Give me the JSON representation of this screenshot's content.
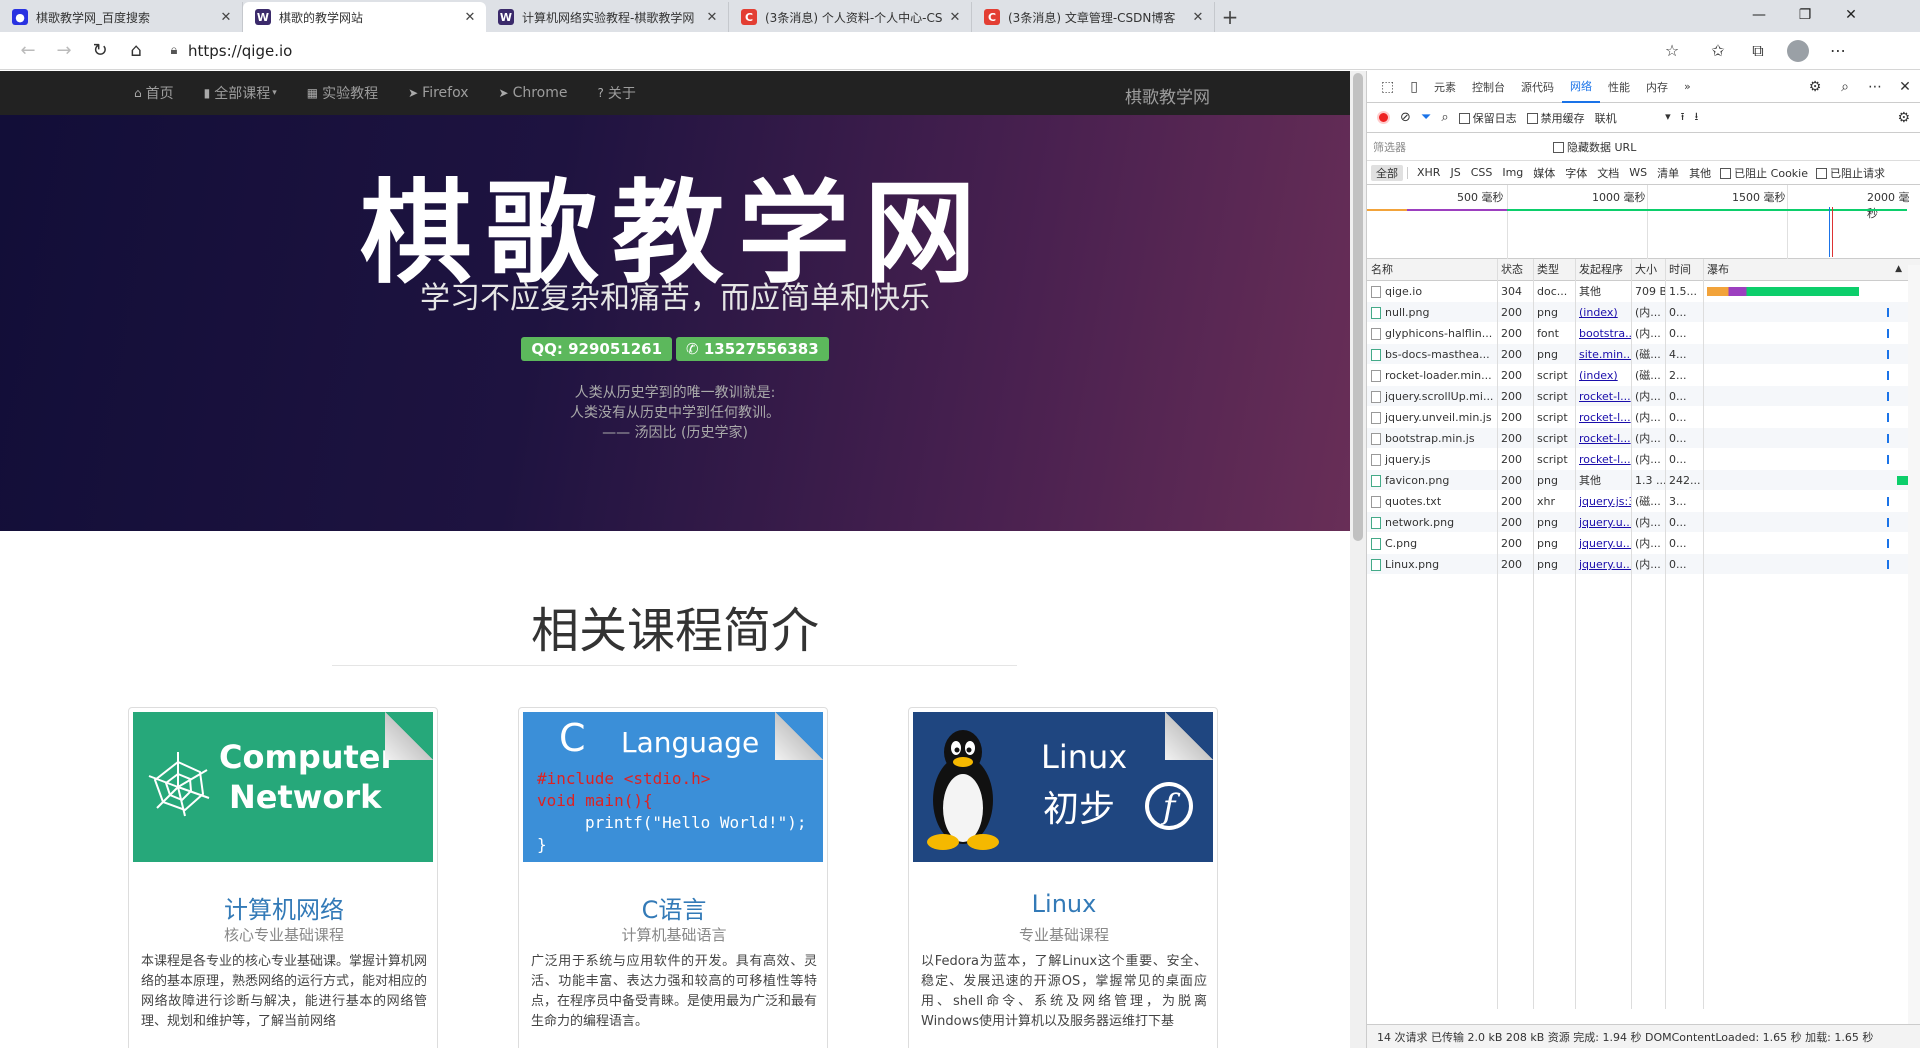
{
  "browser": {
    "tabs": [
      {
        "title": "棋歌教学网_百度搜索",
        "favicon": "paw",
        "color": "#2932e1"
      },
      {
        "title": "棋歌的教学网站",
        "favicon": "W",
        "color": "#3b2a6b",
        "active": true
      },
      {
        "title": "计算机网络实验教程-棋歌教学网",
        "favicon": "W",
        "color": "#3b2a6b"
      },
      {
        "title": "(3条消息) 个人资料-个人中心-CS",
        "favicon": "C",
        "color": "#e33e33"
      },
      {
        "title": "(3条消息) 文章管理-CSDN博客",
        "favicon": "C",
        "color": "#e33e33"
      }
    ],
    "address": "https://qige.io"
  },
  "site": {
    "nav": {
      "home": "首页",
      "courses": "全部课程",
      "labs": "实验教程",
      "firefox": "Firefox",
      "chrome": "Chrome",
      "about": "关于"
    },
    "brand": "棋歌教学网",
    "hero": {
      "title": "棋歌教学网",
      "subtitle": "学习不应复杂和痛苦，而应简单和快乐",
      "qq": "QQ: 929051261",
      "phone": "13527556383",
      "quote1": "人类从历史学到的唯一教训就是:",
      "quote2": "人类没有从历史中学到任何教训。",
      "quote3": "—— 汤因比 (历史学家)"
    },
    "section_title": "相关课程简介",
    "cards": [
      {
        "img_line1": "Computer",
        "img_line2": "Network",
        "title": "计算机网络",
        "sub": "核心专业基础课程",
        "desc": "本课程是各专业的核心专业基础课。掌握计算机网络的基本原理，熟悉网络的运行方式，能对相应的网络故障进行诊断与解决，能进行基本的网络管理、规划和维护等，了解当前网络"
      },
      {
        "img_line1": "C",
        "img_line2": "Language",
        "code1": "#include <stdio.h>",
        "code2": "void main(){",
        "code3": "printf(\"Hello World!\");",
        "code4": "}",
        "title": "C语言",
        "sub": "计算机基础语言",
        "desc": "广泛用于系统与应用软件的开发。具有高效、灵活、功能丰富、表达力强和较高的可移植性等特点，在程序员中备受青睐。是使用最为广泛和最有生命力的编程语言。"
      },
      {
        "img_line1": "Linux",
        "img_line2": "初步",
        "title": "Linux",
        "sub": "专业基础课程",
        "desc": "以Fedora为蓝本，了解Linux这个重要、安全、稳定、发展迅速的开源OS，掌握常见的桌面应用、shell命令、系统及网络管理，为脱离Windows使用计算机以及服务器运维打下基"
      }
    ]
  },
  "devtools": {
    "tabs": [
      "元素",
      "控制台",
      "源代码",
      "网络",
      "性能",
      "内存"
    ],
    "active_tab": "网络",
    "preserve_log": "保留日志",
    "disable_cache": "禁用缓存",
    "throttle": "联机",
    "filter_placeholder": "筛选器",
    "hide_data_url": "隐藏数据 URL",
    "types": [
      "全部",
      "XHR",
      "JS",
      "CSS",
      "Img",
      "媒体",
      "字体",
      "文档",
      "WS",
      "清单",
      "其他"
    ],
    "blocked_cookie": "已阻止 Cookie",
    "blocked_req": "已阻止请求",
    "ticks": [
      "500 毫秒",
      "1000 毫秒",
      "1500 毫秒",
      "2000 毫秒"
    ],
    "columns": [
      "名称",
      "状态",
      "类型",
      "发起程序",
      "大小",
      "时间",
      "瀑布"
    ],
    "rows": [
      {
        "name": "qige.io",
        "status": "304",
        "type": "doc...",
        "initiator": "其他",
        "size": "709 B",
        "time": "1.5..."
      },
      {
        "name": "null.png",
        "status": "200",
        "type": "png",
        "initiator": "(index)",
        "size": "(内...",
        "time": "0..."
      },
      {
        "name": "glyphicons-halflin...",
        "status": "200",
        "type": "font",
        "initiator": "bootstra...",
        "size": "(内...",
        "time": "0..."
      },
      {
        "name": "bs-docs-masthea...",
        "status": "200",
        "type": "png",
        "initiator": "site.min....",
        "size": "(磁...",
        "time": "4..."
      },
      {
        "name": "rocket-loader.min...",
        "status": "200",
        "type": "script",
        "initiator": "(index)",
        "size": "(磁...",
        "time": "2..."
      },
      {
        "name": "jquery.scrollUp.mi...",
        "status": "200",
        "type": "script",
        "initiator": "rocket-l...",
        "size": "(内...",
        "time": "0..."
      },
      {
        "name": "jquery.unveil.min.js",
        "status": "200",
        "type": "script",
        "initiator": "rocket-l...",
        "size": "(内...",
        "time": "0..."
      },
      {
        "name": "bootstrap.min.js",
        "status": "200",
        "type": "script",
        "initiator": "rocket-l...",
        "size": "(内...",
        "time": "0..."
      },
      {
        "name": "jquery.js",
        "status": "200",
        "type": "script",
        "initiator": "rocket-l...",
        "size": "(内...",
        "time": "0..."
      },
      {
        "name": "favicon.png",
        "status": "200",
        "type": "png",
        "initiator": "其他",
        "size": "1.3 ...",
        "time": "242..."
      },
      {
        "name": "quotes.txt",
        "status": "200",
        "type": "xhr",
        "initiator": "jquery.js:3",
        "size": "(磁...",
        "time": "3..."
      },
      {
        "name": "network.png",
        "status": "200",
        "type": "png",
        "initiator": "jquery.u...",
        "size": "(内...",
        "time": "0..."
      },
      {
        "name": "C.png",
        "status": "200",
        "type": "png",
        "initiator": "jquery.u...",
        "size": "(内...",
        "time": "0..."
      },
      {
        "name": "Linux.png",
        "status": "200",
        "type": "png",
        "initiator": "jquery.u...",
        "size": "(内...",
        "time": "0..."
      }
    ],
    "status_bar": "14 次请求  已传输 2.0 kB  208 kB 资源  完成: 1.94 秒  DOMContentLoaded: 1.65 秒  加载: 1.65 秒"
  }
}
